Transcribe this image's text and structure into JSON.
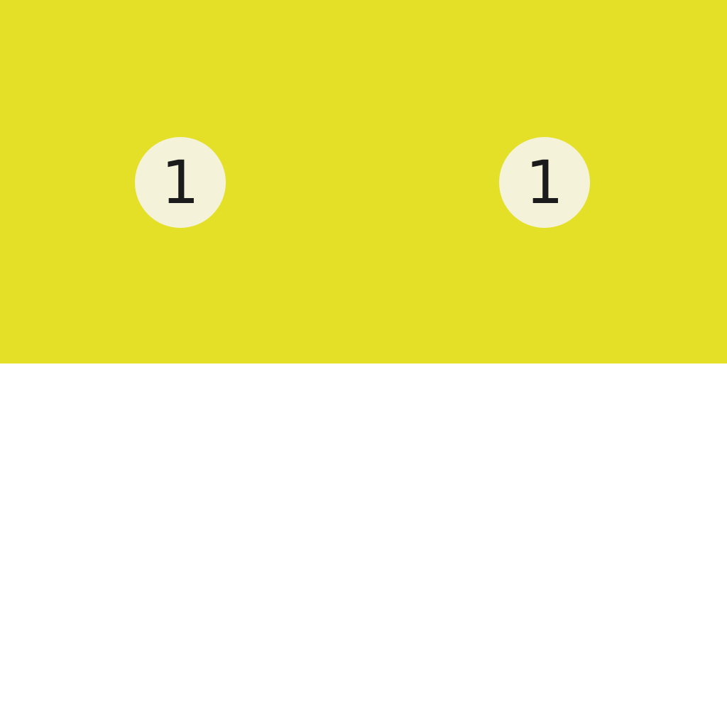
{
  "badges": {
    "left": {
      "number": "1"
    },
    "right": {
      "number": "1"
    }
  },
  "colors": {
    "top_panel": "#e3e027",
    "badge_fill": "#f4f2d8",
    "badge_text": "#1b1b1b",
    "bottom_panel": "#ffffff"
  }
}
